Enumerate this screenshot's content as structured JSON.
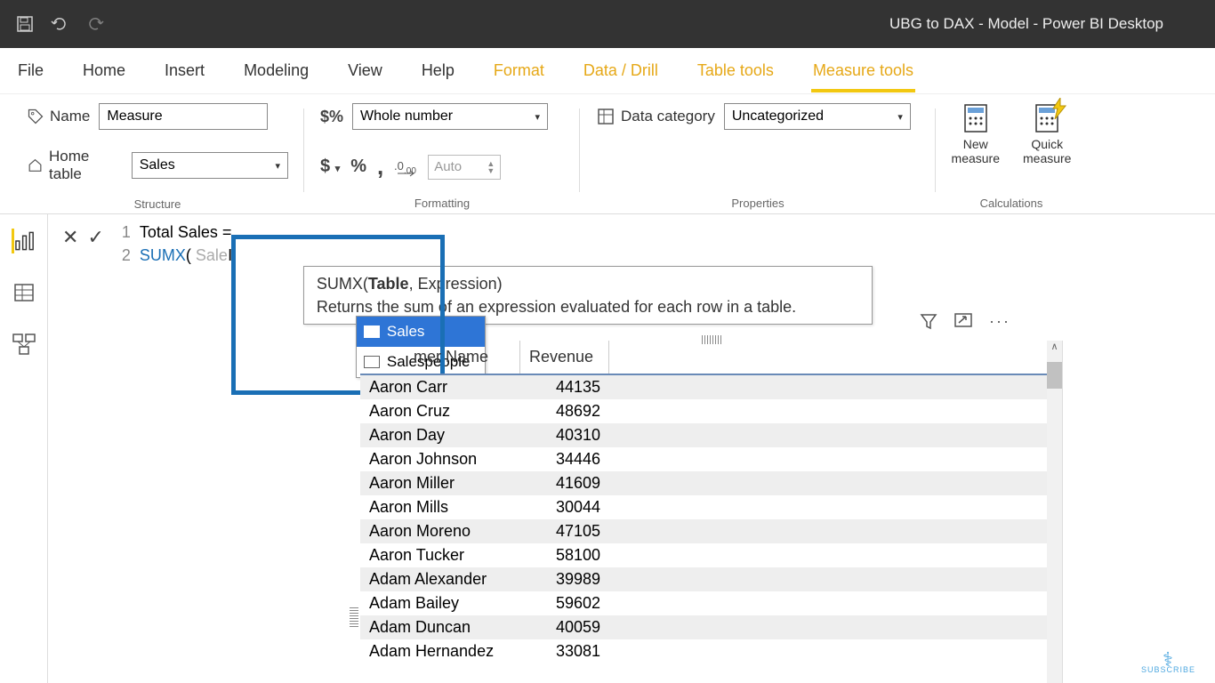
{
  "titlebar": {
    "title": "UBG to DAX - Model - Power BI Desktop"
  },
  "tabs": {
    "file": "File",
    "home": "Home",
    "insert": "Insert",
    "modeling": "Modeling",
    "view": "View",
    "help": "Help",
    "format": "Format",
    "datadrill": "Data / Drill",
    "tabletools": "Table tools",
    "measuretools": "Measure tools"
  },
  "ribbon": {
    "structure": {
      "name_label": "Name",
      "name_value": "Measure",
      "home_table_label": "Home table",
      "home_table_value": "Sales",
      "group_label": "Structure"
    },
    "formatting": {
      "format_value": "Whole number",
      "auto_placeholder": "Auto",
      "group_label": "Formatting"
    },
    "properties": {
      "data_category_label": "Data category",
      "data_category_value": "Uncategorized",
      "group_label": "Properties"
    },
    "calculations": {
      "new_measure": "New\nmeasure",
      "quick_measure": "Quick\nmeasure",
      "group_label": "Calculations"
    }
  },
  "formula": {
    "line1": "Total Sales =",
    "line2_kw": "SUMX",
    "line2_open": "(",
    "line2_typed": "Sale",
    "tooltip_fn": "SUMX",
    "tooltip_sig_open": "(",
    "tooltip_sig_bold": "Table",
    "tooltip_sig_rest": ", Expression)",
    "tooltip_desc": "Returns the sum of an expression evaluated for each row in a table."
  },
  "autocomplete": {
    "items": [
      "Sales",
      "Salespeople"
    ],
    "selected_index": 0
  },
  "table": {
    "columns": {
      "name": "mer Name",
      "rev": "Revenue"
    },
    "rows": [
      {
        "name": "Aaron Carr",
        "rev": "44135"
      },
      {
        "name": "Aaron Cruz",
        "rev": "48692"
      },
      {
        "name": "Aaron Day",
        "rev": "40310"
      },
      {
        "name": "Aaron Johnson",
        "rev": "34446"
      },
      {
        "name": "Aaron Miller",
        "rev": "41609"
      },
      {
        "name": "Aaron Mills",
        "rev": "30044"
      },
      {
        "name": "Aaron Moreno",
        "rev": "47105"
      },
      {
        "name": "Aaron Tucker",
        "rev": "58100"
      },
      {
        "name": "Adam Alexander",
        "rev": "39989"
      },
      {
        "name": "Adam Bailey",
        "rev": "59602"
      },
      {
        "name": "Adam Duncan",
        "rev": "40059"
      },
      {
        "name": "Adam Hernandez",
        "rev": "33081"
      }
    ]
  },
  "subscribe": "SUBSCRIBE"
}
